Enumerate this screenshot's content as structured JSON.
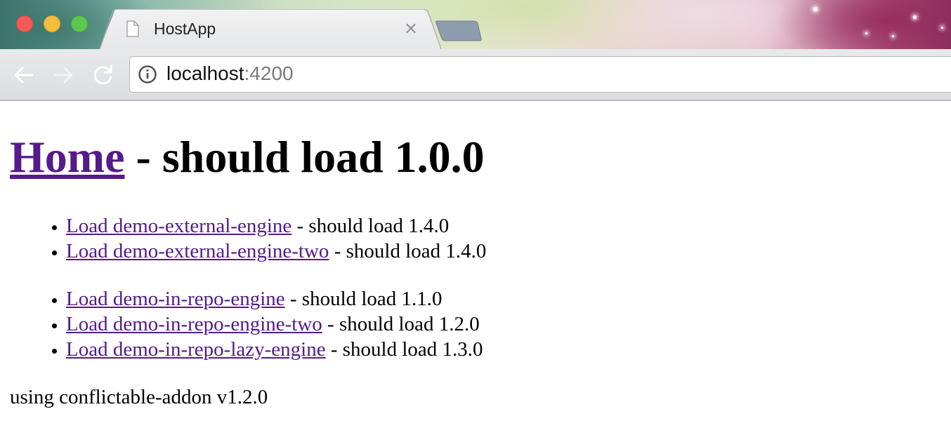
{
  "browser": {
    "tab": {
      "title": "HostApp",
      "close_glyph": "×",
      "icon": "document-icon"
    },
    "address_bar": {
      "host": "localhost",
      "port": ":4200",
      "icon": "info-icon"
    },
    "nav": {
      "back_icon": "back-arrow-icon",
      "forward_icon": "forward-arrow-icon",
      "reload_icon": "reload-icon"
    }
  },
  "page": {
    "heading": {
      "link": "Home",
      "text": " - should load 1.0.0"
    },
    "external_engines": [
      {
        "link": "Load demo-external-engine",
        "text": " - should load 1.4.0"
      },
      {
        "link": "Load demo-external-engine-two",
        "text": " - should load 1.4.0"
      }
    ],
    "in_repo_engines": [
      {
        "link": "Load demo-in-repo-engine",
        "text": " - should load 1.1.0"
      },
      {
        "link": "Load demo-in-repo-engine-two",
        "text": " - should load 1.2.0"
      },
      {
        "link": "Load demo-in-repo-lazy-engine",
        "text": " - should load 1.3.0"
      }
    ],
    "footer": "using conflictable-addon v1.2.0"
  },
  "colors": {
    "link_visited": "#551a8b",
    "traffic_close": "#f25a55",
    "traffic_minimize": "#f4bd3b",
    "traffic_maximize": "#5cc94e"
  }
}
